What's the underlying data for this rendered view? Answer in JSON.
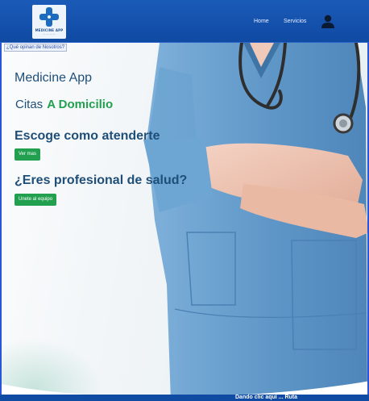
{
  "header": {
    "logo": {
      "icon": "medical-cross-icon",
      "brand": "MEDICINE APP",
      "tagline": "— — — —"
    },
    "nav": {
      "home_label": "Home",
      "services_label": "Servicios",
      "user_icon": "user-icon"
    }
  },
  "hero": {
    "about_link": "¿Qué opinan de Nosotros?",
    "title": "Medicine App",
    "subtitle_prefix": "Citas",
    "subtitle_accent": "A Domicilio",
    "care_heading": "Escoge como atenderte",
    "care_button": "Ver mas",
    "pro_heading": "¿Eres profesional de salud?",
    "pro_button": "Unete al equipo"
  },
  "footer": {
    "partial_text": "Dando clic aquí ... Ruta"
  },
  "colors": {
    "header": "#0f4aa3",
    "title_text": "#1f4f78",
    "accent_green": "#22a04f",
    "scrubs": "#5f97c8"
  }
}
